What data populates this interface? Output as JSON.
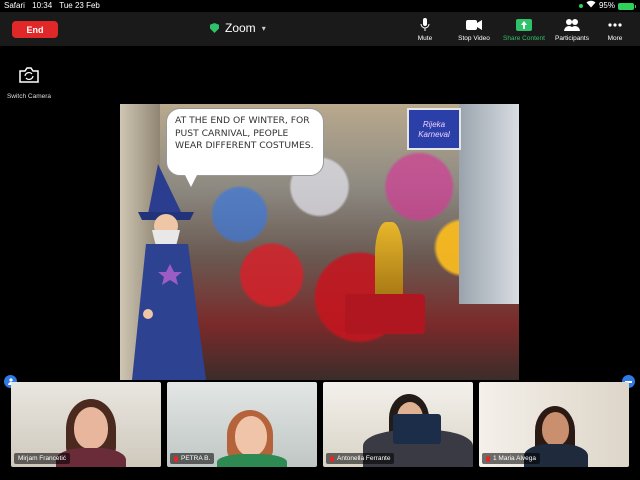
{
  "status_bar": {
    "carrier": "Safari",
    "time": "10:34",
    "date": "Tue 23 Feb",
    "battery": "95%"
  },
  "toolbar": {
    "end_label": "End",
    "meeting_title": "Zoom",
    "buttons": [
      {
        "label": "Mute",
        "icon": "microphone-icon"
      },
      {
        "label": "Stop Video",
        "icon": "video-camera-icon"
      },
      {
        "label": "Share Content",
        "icon": "share-screen-icon"
      },
      {
        "label": "Participants",
        "icon": "participants-icon"
      },
      {
        "label": "More",
        "icon": "more-dots-icon"
      }
    ]
  },
  "switch_camera": {
    "label": "Switch Camera",
    "icon": "camera-switch-icon"
  },
  "shared_content": {
    "speech_text": "At the end of winter, for Pust carnival, people wear different costumes.",
    "banner_text": "Rijeka Karneval"
  },
  "participants": [
    {
      "name": "Mirjam Francetić",
      "muted": false
    },
    {
      "name": "PETRA B.",
      "muted": true
    },
    {
      "name": "Antonella Ferrante",
      "muted": true
    },
    {
      "name": "1 Maria Alvega",
      "muted": true
    }
  ],
  "colors": {
    "end_red": "#e02828",
    "share_green": "#2ec26b",
    "toolbar_bg": "#1a1a1a",
    "nav_blue": "#2f7ae5"
  }
}
